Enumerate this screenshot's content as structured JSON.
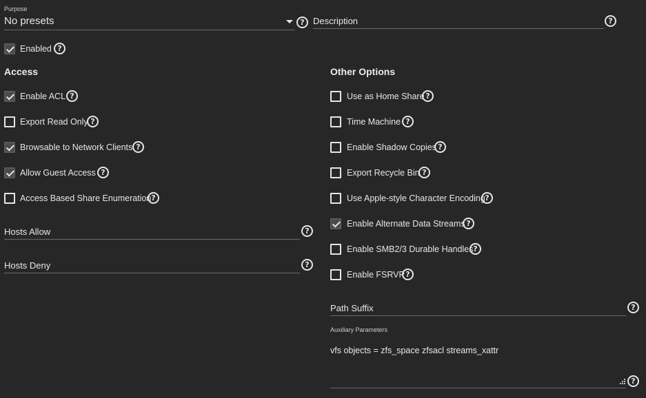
{
  "purpose": {
    "label": "Purpose",
    "value": "No presets"
  },
  "description": {
    "placeholder": "Description"
  },
  "enabled": {
    "label": "Enabled",
    "checked": true
  },
  "access": {
    "title": "Access",
    "options": [
      {
        "label": "Enable ACL",
        "checked": true
      },
      {
        "label": "Export Read Only",
        "checked": false
      },
      {
        "label": "Browsable to Network Clients",
        "checked": true
      },
      {
        "label": "Allow Guest Access",
        "checked": true
      },
      {
        "label": "Access Based Share Enumeration",
        "checked": false
      }
    ],
    "hosts_allow": {
      "placeholder": "Hosts Allow"
    },
    "hosts_deny": {
      "placeholder": "Hosts Deny"
    }
  },
  "other": {
    "title": "Other Options",
    "options": [
      {
        "label": "Use as Home Share",
        "checked": false
      },
      {
        "label": "Time Machine",
        "checked": false
      },
      {
        "label": "Enable Shadow Copies",
        "checked": false
      },
      {
        "label": "Export Recycle Bin",
        "checked": false
      },
      {
        "label": "Use Apple-style Character Encoding",
        "checked": false
      },
      {
        "label": "Enable Alternate Data Streams",
        "checked": true
      },
      {
        "label": "Enable SMB2/3 Durable Handles",
        "checked": false
      },
      {
        "label": "Enable FSRVP",
        "checked": false
      }
    ],
    "path_suffix": {
      "placeholder": "Path Suffix"
    },
    "aux": {
      "label": "Auxiliary Parameters",
      "value": "vfs objects = zfs_space zfsacl streams_xattr"
    }
  },
  "help_glyph": "?"
}
